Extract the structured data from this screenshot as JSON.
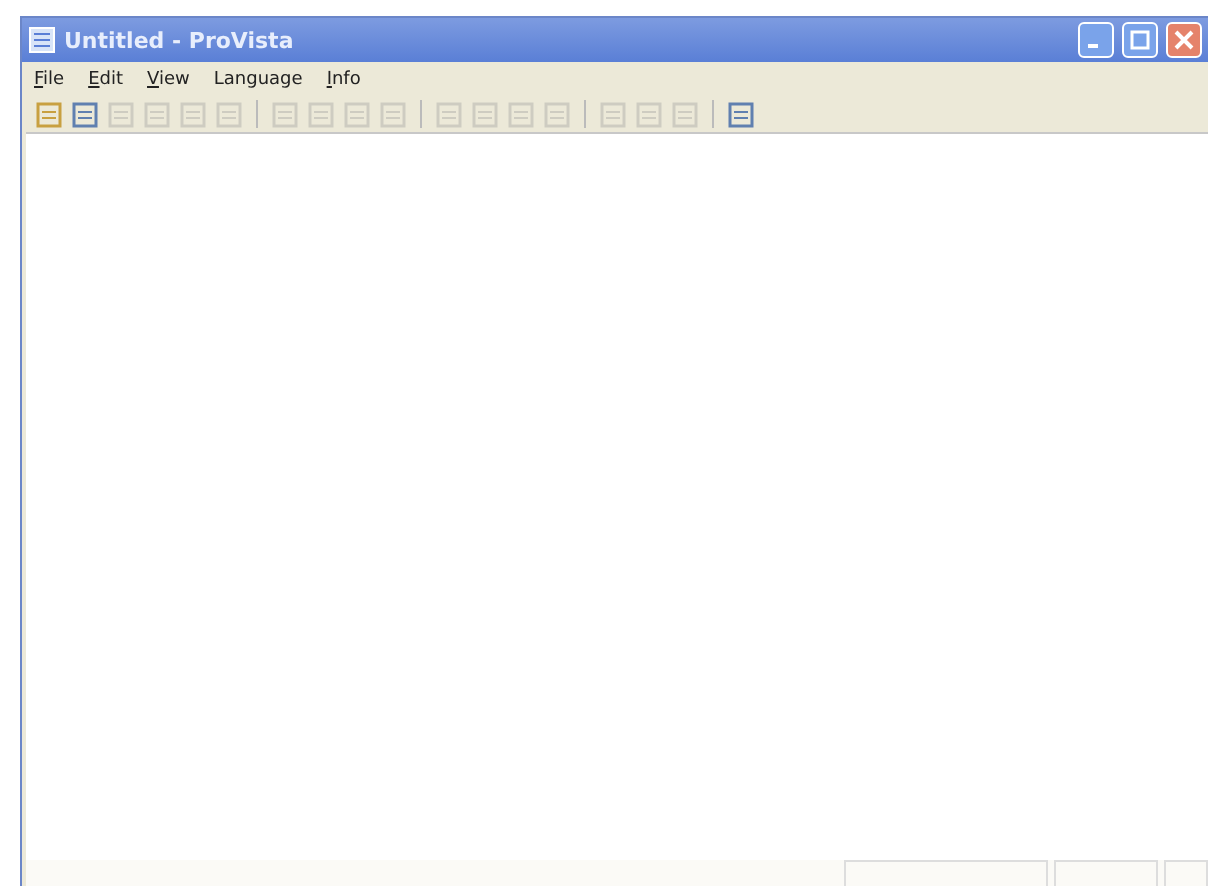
{
  "window": {
    "title": "Untitled - ProVista"
  },
  "menu": [
    {
      "label": "File",
      "underlined_first": true
    },
    {
      "label": "Edit",
      "underlined_first": true
    },
    {
      "label": "View",
      "underlined_first": true
    },
    {
      "label": "Language",
      "underlined_first": false
    },
    {
      "label": "Info",
      "underlined_first": true
    }
  ],
  "toolbar": [
    {
      "kind": "button",
      "disabled": false
    },
    {
      "kind": "button",
      "disabled": false
    },
    {
      "kind": "button",
      "disabled": true
    },
    {
      "kind": "button",
      "disabled": true
    },
    {
      "kind": "button",
      "disabled": true
    },
    {
      "kind": "button",
      "disabled": true
    },
    {
      "kind": "separator"
    },
    {
      "kind": "button",
      "disabled": true
    },
    {
      "kind": "button",
      "disabled": true
    },
    {
      "kind": "button",
      "disabled": true
    },
    {
      "kind": "button",
      "disabled": true
    },
    {
      "kind": "separator"
    },
    {
      "kind": "button",
      "disabled": true
    },
    {
      "kind": "button",
      "disabled": true
    },
    {
      "kind": "button",
      "disabled": true
    },
    {
      "kind": "button",
      "disabled": true
    },
    {
      "kind": "separator"
    },
    {
      "kind": "button",
      "disabled": true
    },
    {
      "kind": "button",
      "disabled": true
    },
    {
      "kind": "button",
      "disabled": true
    },
    {
      "kind": "separator"
    },
    {
      "kind": "button",
      "disabled": false
    }
  ]
}
